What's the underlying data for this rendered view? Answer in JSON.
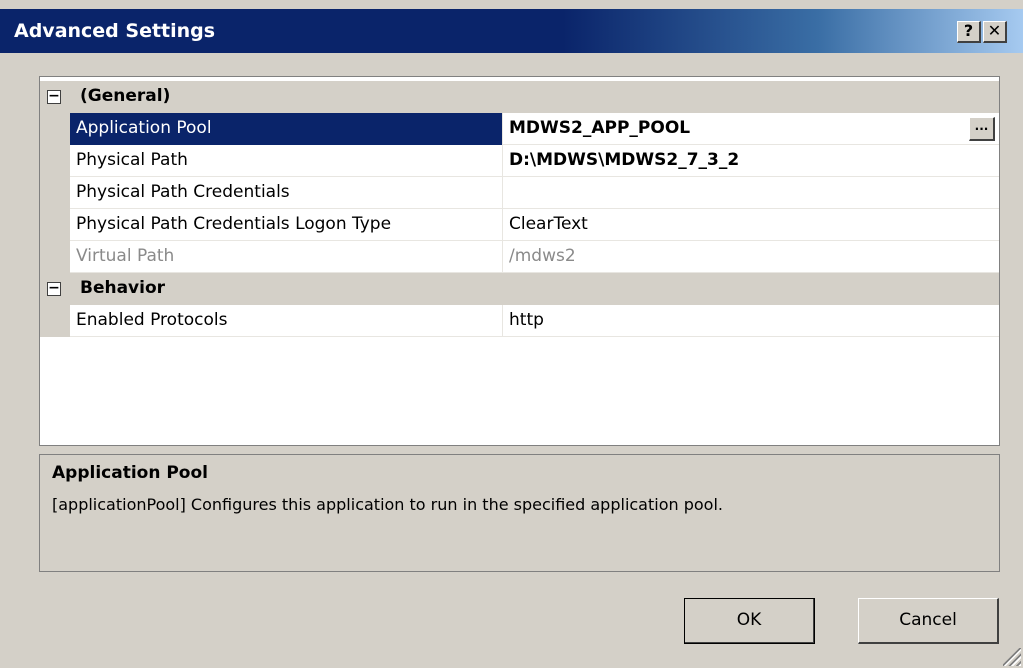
{
  "window": {
    "title": "Advanced Settings",
    "help_label": "?",
    "close_label": "✕"
  },
  "grid": {
    "categories": [
      {
        "label": "(General)",
        "expander": "−",
        "properties": [
          {
            "name": "Application Pool",
            "value": "MDWS2_APP_POOL",
            "selected": true,
            "bold": true,
            "has_ellipsis": true
          },
          {
            "name": "Physical Path",
            "value": "D:\\MDWS\\MDWS2_7_3_2",
            "bold": true
          },
          {
            "name": "Physical Path Credentials",
            "value": ""
          },
          {
            "name": "Physical Path Credentials Logon Type",
            "value": "ClearText"
          },
          {
            "name": "Virtual Path",
            "value": "/mdws2",
            "disabled": true
          }
        ]
      },
      {
        "label": "Behavior",
        "expander": "−",
        "properties": [
          {
            "name": "Enabled Protocols",
            "value": "http"
          }
        ]
      }
    ],
    "ellipsis_label": "..."
  },
  "help": {
    "title": "Application Pool",
    "description": "[applicationPool] Configures this application to run in the specified application pool."
  },
  "buttons": {
    "ok": "OK",
    "cancel": "Cancel"
  }
}
